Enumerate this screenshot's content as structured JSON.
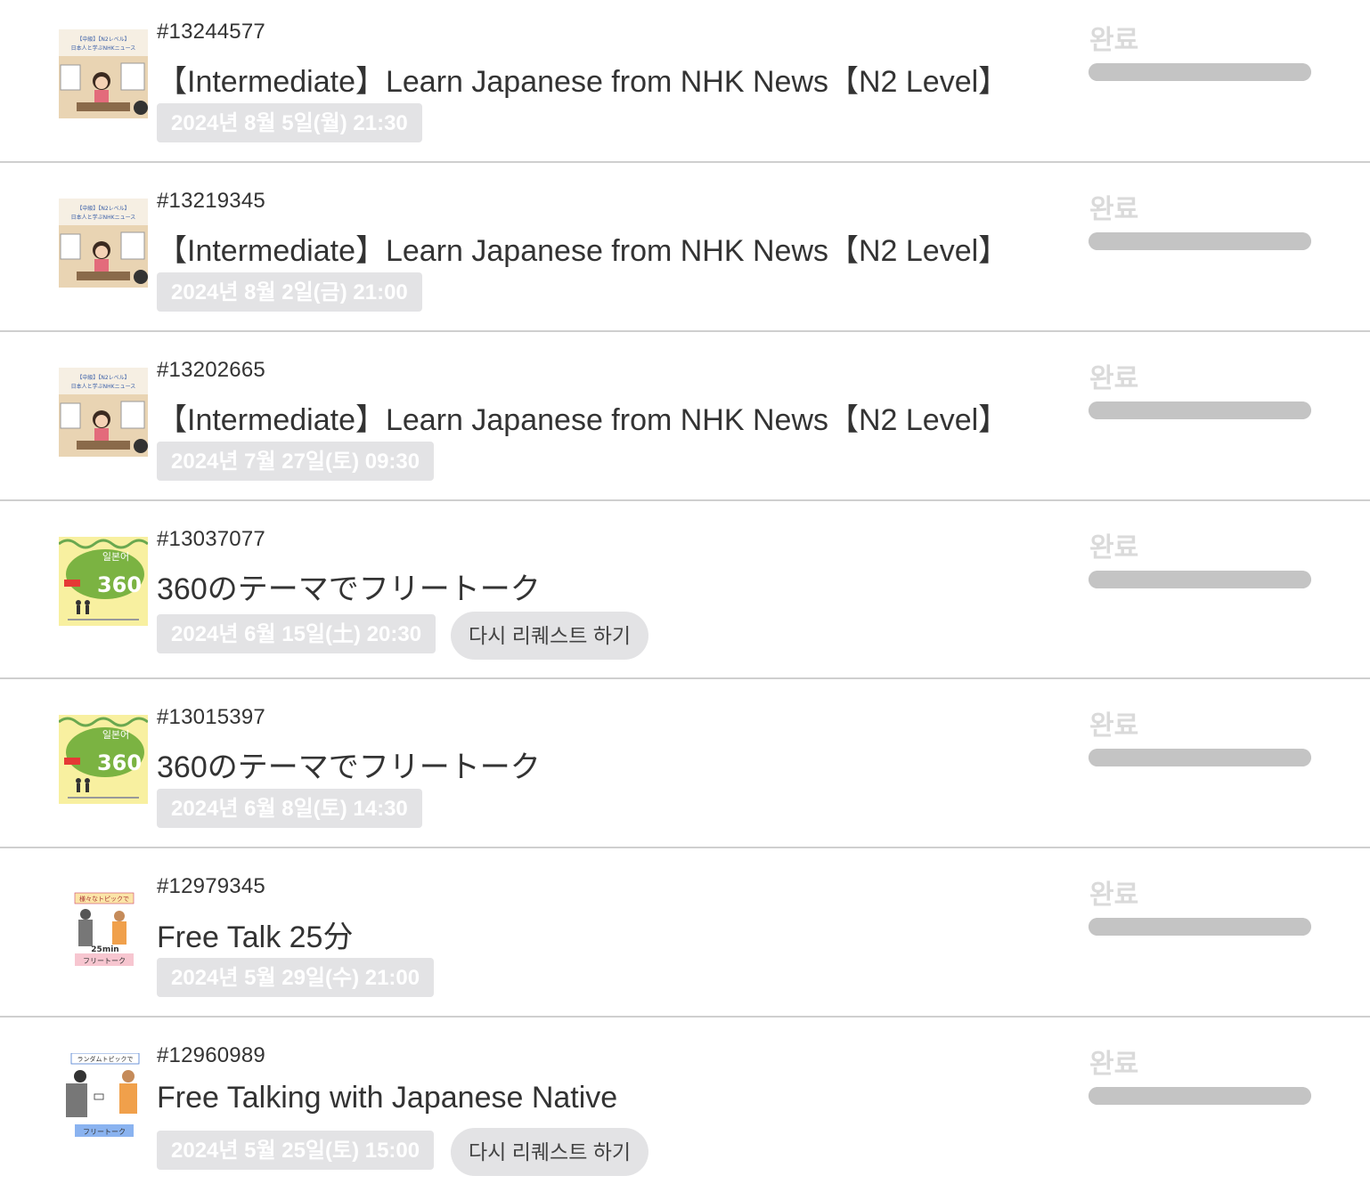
{
  "colors": {
    "date_pill_bg": "#e3e3e5",
    "status_text": "#dadada",
    "progress_bar": "#c4c4c4",
    "divider": "#cfcfcf"
  },
  "lessons": [
    {
      "id": "#13244577",
      "title": "【Intermediate】Learn Japanese from NHK News【N2 Level】",
      "date": "2024년 8월 5일(월) 21:30",
      "status": "완료",
      "progress": 1.0,
      "thumbnail": "nhk-news-thumbnail",
      "thumb_text_1": "【中級】【N2レベル】",
      "thumb_text_2": "日本人と学ぶNHKニュース"
    },
    {
      "id": "#13219345",
      "title": "【Intermediate】Learn Japanese from NHK News【N2 Level】",
      "date": "2024년 8월 2일(금) 21:00",
      "status": "완료",
      "progress": 1.0,
      "thumbnail": "nhk-news-thumbnail",
      "thumb_text_1": "【中級】【N2レベル】",
      "thumb_text_2": "日本人と学ぶNHKニュース"
    },
    {
      "id": "#13202665",
      "title": "【Intermediate】Learn Japanese from NHK News【N2 Level】",
      "date": "2024년 7월 27일(토) 09:30",
      "status": "완료",
      "progress": 1.0,
      "thumbnail": "nhk-news-thumbnail",
      "thumb_text_1": "【中級】【N2レベル】",
      "thumb_text_2": "日本人と学ぶNHKニュース"
    },
    {
      "id": "#13037077",
      "title": "360のテーマでフリートーク",
      "date": "2024년 6월 15일(土) 20:30",
      "status": "완료",
      "progress": 1.0,
      "button": "다시 리퀘스트 하기",
      "thumbnail": "free-talk-360-thumbnail",
      "thumb_text_1": "일본어",
      "thumb_text_2": "360"
    },
    {
      "id": "#13015397",
      "title": "360のテーマでフリートーク",
      "date": "2024년 6월 8일(토) 14:30",
      "status": "완료",
      "progress": 1.0,
      "thumbnail": "free-talk-360-thumbnail",
      "thumb_text_1": "일본어",
      "thumb_text_2": "360"
    },
    {
      "id": "#12979345",
      "title": "Free Talk 25分",
      "date": "2024년 5월 29일(수) 21:00",
      "status": "완료",
      "progress": 1.0,
      "thumbnail": "free-talk-25min-thumbnail",
      "thumb_text_1": "様々なトピックで",
      "thumb_text_2": "25min",
      "thumb_text_3": "フリートーク"
    },
    {
      "id": "#12960989",
      "title": "Free Talking with Japanese Native",
      "date": "2024년 5월 25일(토) 15:00",
      "status": "완료",
      "progress": 1.0,
      "button": "다시 리퀘스트 하기",
      "thumbnail": "free-talking-native-thumbnail",
      "thumb_text_1": "ランダムトピックで",
      "thumb_text_3": "フリートーク"
    }
  ]
}
